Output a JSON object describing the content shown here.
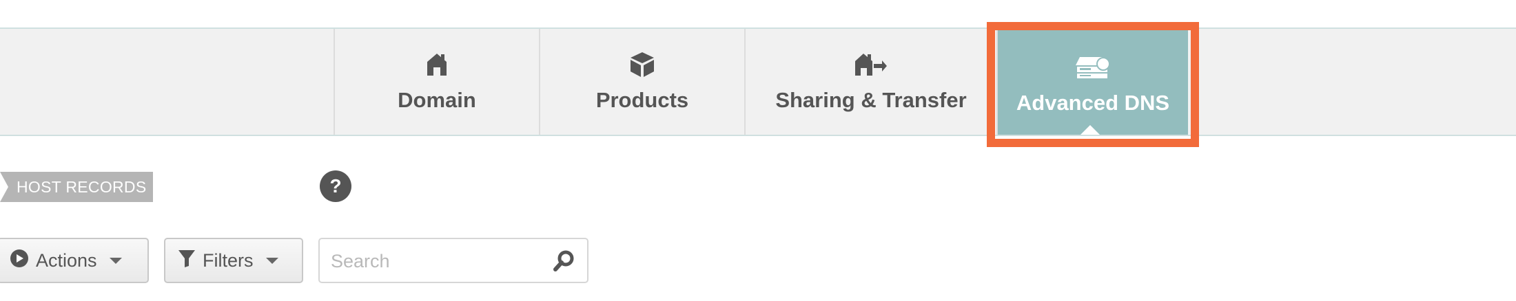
{
  "tabs": [
    {
      "label": "Domain",
      "icon": "home-icon",
      "active": false
    },
    {
      "label": "Products",
      "icon": "box-icon",
      "active": false
    },
    {
      "label": "Sharing & Transfer",
      "icon": "home-arrow-icon",
      "active": false
    },
    {
      "label": "Advanced DNS",
      "icon": "server-icon",
      "active": true
    }
  ],
  "section": {
    "label": "HOST RECORDS",
    "help_glyph": "?"
  },
  "toolbar": {
    "actions_label": "Actions",
    "filters_label": "Filters",
    "search_placeholder": "Search"
  },
  "colors": {
    "active_tab": "#93bdbe",
    "highlight": "#f26b3a",
    "tabbar_bg": "#f1f1f1"
  }
}
